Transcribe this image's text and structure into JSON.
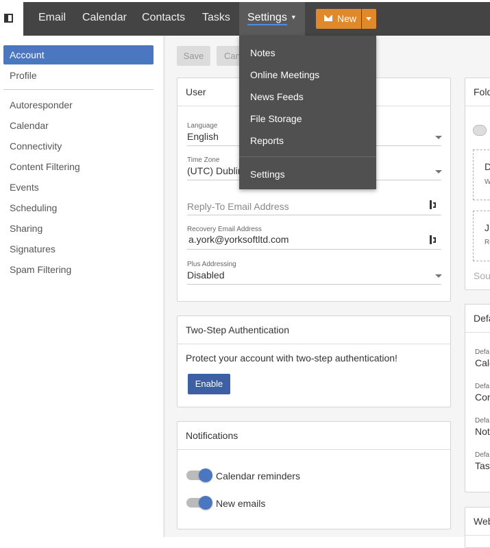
{
  "topnav": {
    "items": [
      "Email",
      "Calendar",
      "Contacts",
      "Tasks"
    ],
    "settings_label": "Settings",
    "new_label": "New"
  },
  "sidebar": {
    "items": [
      "Account",
      "Profile",
      "Autoresponder",
      "Calendar",
      "Connectivity",
      "Content Filtering",
      "Events",
      "Scheduling",
      "Sharing",
      "Signatures",
      "Spam Filtering"
    ]
  },
  "toolbar": {
    "save_label": "Save",
    "cancel_label": "Can"
  },
  "user_card": {
    "title": "User",
    "language_label": "Language",
    "language_value": "English",
    "timezone_label": "Time Zone",
    "timezone_value": "(UTC) Dublin",
    "reply_to_placeholder": "Reply-To Email Address",
    "recovery_label": "Recovery Email Address",
    "recovery_value": "a.york@yorksoftltd.com",
    "plus_label": "Plus Addressing",
    "plus_value": "Disabled"
  },
  "two_step": {
    "title": "Two-Step Authentication",
    "description": "Protect your account with two-step authentication!",
    "enable_label": "Enable"
  },
  "notifications": {
    "title": "Notifications",
    "items": [
      {
        "label": "Calendar reminders",
        "enabled": true
      },
      {
        "label": "New emails",
        "enabled": true
      }
    ]
  },
  "right_cards": {
    "folders_title": "Fold",
    "folder_item1_title": "D",
    "folder_item1_sub": "W",
    "folder_item2_title": "J",
    "folder_item2_sub": "Re",
    "folder_footer": "Sou",
    "defaults_title": "Defa",
    "defaults": [
      {
        "label": "Defa",
        "value": "Cale"
      },
      {
        "label": "Defa",
        "value": "Cor"
      },
      {
        "label": "Defa",
        "value": "Not"
      },
      {
        "label": "Defa",
        "value": "Tas"
      }
    ],
    "web_title": "Web"
  },
  "settings_menu": {
    "items": [
      "Notes",
      "Online Meetings",
      "News Feeds",
      "File Storage",
      "Reports"
    ],
    "footer_item": "Settings"
  },
  "colors": {
    "accent": "#4a77c0",
    "new_button": "#e0892a",
    "topbar": "#444444",
    "enable_button": "#3d5fa3"
  }
}
